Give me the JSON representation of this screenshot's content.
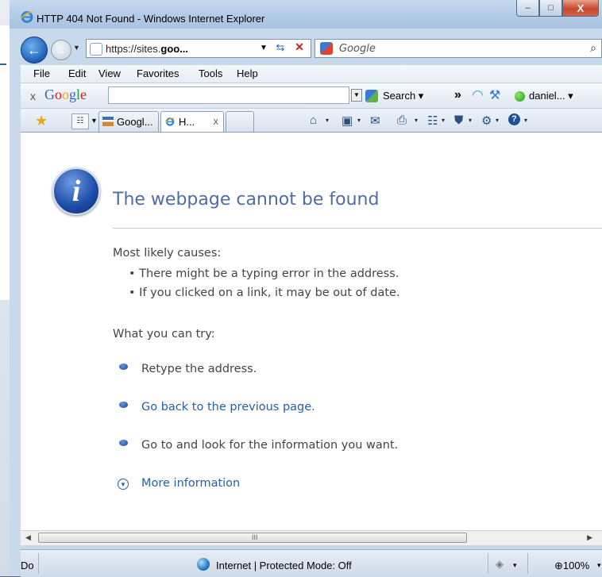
{
  "window": {
    "title": "HTTP 404 Not Found - Windows Internet Explorer",
    "minimize_glyph": "–",
    "maximize_glyph": "□",
    "close_glyph": "X"
  },
  "address_bar": {
    "url_prefix": "https://sites.",
    "url_bold": "goo...",
    "refresh_glyph": "⇆",
    "stop_glyph": "✕"
  },
  "search_box": {
    "placeholder": "Google",
    "search_glyph": "⌕"
  },
  "menu": [
    "File",
    "Edit",
    "View",
    "Favorites",
    "Tools",
    "Help"
  ],
  "google_toolbar": {
    "close_glyph": "x",
    "logo_letters": [
      "G",
      "o",
      "o",
      "g",
      "l",
      "e"
    ],
    "logo_colors": [
      "#3366cc",
      "#cc2211",
      "#eeaa00",
      "#3366cc",
      "#229933",
      "#cc2211"
    ],
    "search_label": "Search ▾",
    "more_glyph": "»",
    "user_label": "daniel... ▾"
  },
  "tabs": [
    {
      "label": "Googl...",
      "active": false
    },
    {
      "label": "H...",
      "active": true,
      "close_glyph": "x"
    }
  ],
  "command_bar": {
    "home_glyph": "⌂",
    "feeds_glyph": "▣",
    "mail_glyph": "✉",
    "print_glyph": "⎙",
    "page_glyph": "☷",
    "safety_glyph": "⛊",
    "tools_glyph": "⚙",
    "help_glyph": "?",
    "dropdown_glyph": "▾"
  },
  "page": {
    "info_glyph": "i",
    "title": "The webpage cannot be found",
    "causes_heading": "Most likely causes:",
    "causes": [
      "•  There might be a typing error in the address.",
      "•  If you clicked on a link, it may be out of date."
    ],
    "try_heading": "What you can try:",
    "try_items": [
      {
        "text": "Retype the address.",
        "link": false
      },
      {
        "text": "Go back to the previous page.",
        "link": true
      },
      {
        "text": "Go to  and look for the information you want.",
        "link": false
      }
    ],
    "more_info": "More information",
    "more_glyph": "▼"
  },
  "scrollbar": {
    "left_glyph": "◀",
    "right_glyph": "▶",
    "grip_glyph": "III"
  },
  "status_bar": {
    "status": "Do",
    "zone": "Internet | Protected Mode: Off",
    "zoom": "⊕100%",
    "lock_glyph": "◈",
    "dropdown_glyph": "▾"
  },
  "colors": {
    "title_link": "#4f6da3",
    "link": "#2660a6",
    "body_text": "#444444",
    "close_button": "#c9472d"
  }
}
